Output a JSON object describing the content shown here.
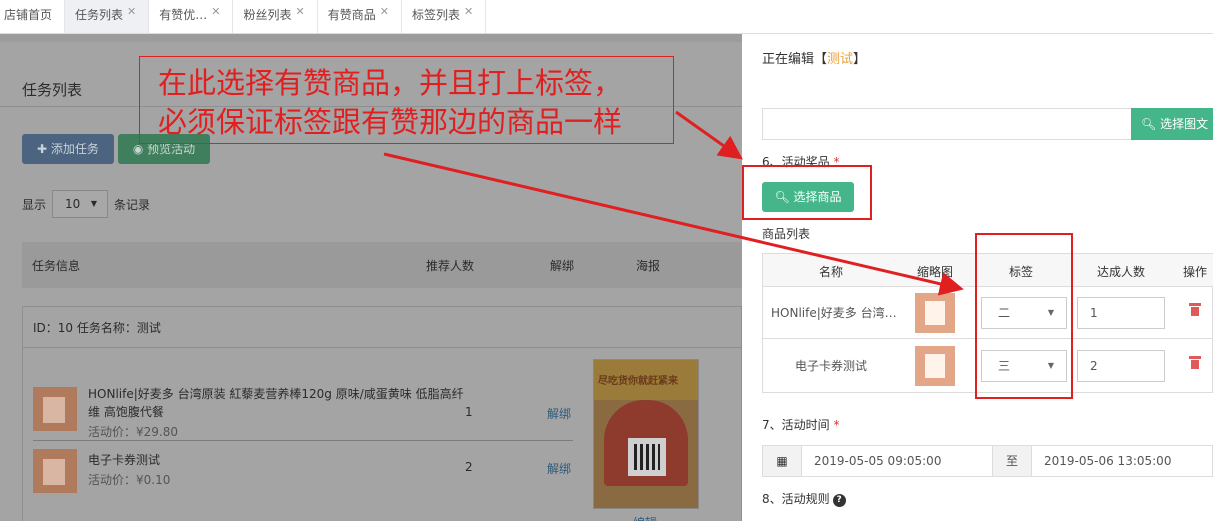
{
  "tabs": [
    {
      "label": "店铺首页",
      "closable": false
    },
    {
      "label": "任务列表",
      "closable": true
    },
    {
      "label": "有赞优…",
      "closable": true
    },
    {
      "label": "粉丝列表",
      "closable": true
    },
    {
      "label": "有赞商品",
      "closable": true
    },
    {
      "label": "标签列表",
      "closable": true
    }
  ],
  "close_glyph": "✕",
  "left": {
    "title": "任务列表",
    "add_button": "添加任务",
    "preview_button": "预览活动",
    "show_prefix": "显示",
    "page_size": "10",
    "show_suffix": "条记录",
    "columns": [
      "任务信息",
      "推荐人数",
      "解绑",
      "海报"
    ],
    "task_id_line": "ID：10   任务名称：测试",
    "products": [
      {
        "name": "HONlife|好麦多 台湾原装 紅藜麦营养棒120g 原味/咸蛋黄味 低脂高纤维 高饱腹代餐",
        "price": "活动价：¥29.80",
        "count": "1",
        "action": "解绑"
      },
      {
        "name": "电子卡券测试",
        "price": "活动价：¥0.10",
        "count": "2",
        "action": "解绑"
      }
    ],
    "poster_text": "尽吃货你就赶紧来",
    "edit_link": "编辑"
  },
  "annotation": {
    "line1": "在此选择有赞商品，并且打上标签，",
    "line2": "必须保证标签跟有赞那边的商品一样"
  },
  "right": {
    "editing_prefix": "正在编辑【",
    "editing_name": "测试",
    "editing_suffix": "】",
    "select_image_button": "选择图文",
    "reward_label": "6、活动奖品",
    "select_goods_button": "选择商品",
    "goods_list_label": "商品列表",
    "goods_columns": [
      "名称",
      "缩略图",
      "标签",
      "达成人数",
      "操作"
    ],
    "goods": [
      {
        "name": "HONlife|好麦多 台湾原装 紅藜麦营养棒",
        "tag": "二",
        "target": "1"
      },
      {
        "name": "电子卡券测试",
        "tag": "三",
        "target": "2"
      }
    ],
    "time_label": "7、活动时间",
    "start_time": "2019-05-05 09:05:00",
    "to_label": "至",
    "end_time": "2019-05-06 13:05:00",
    "rules_label": "8、活动规则",
    "required_mark": "*"
  },
  "colors": {
    "annotation_red": "#e02020",
    "green": "#44b68a",
    "orange": "#e8a23a"
  }
}
